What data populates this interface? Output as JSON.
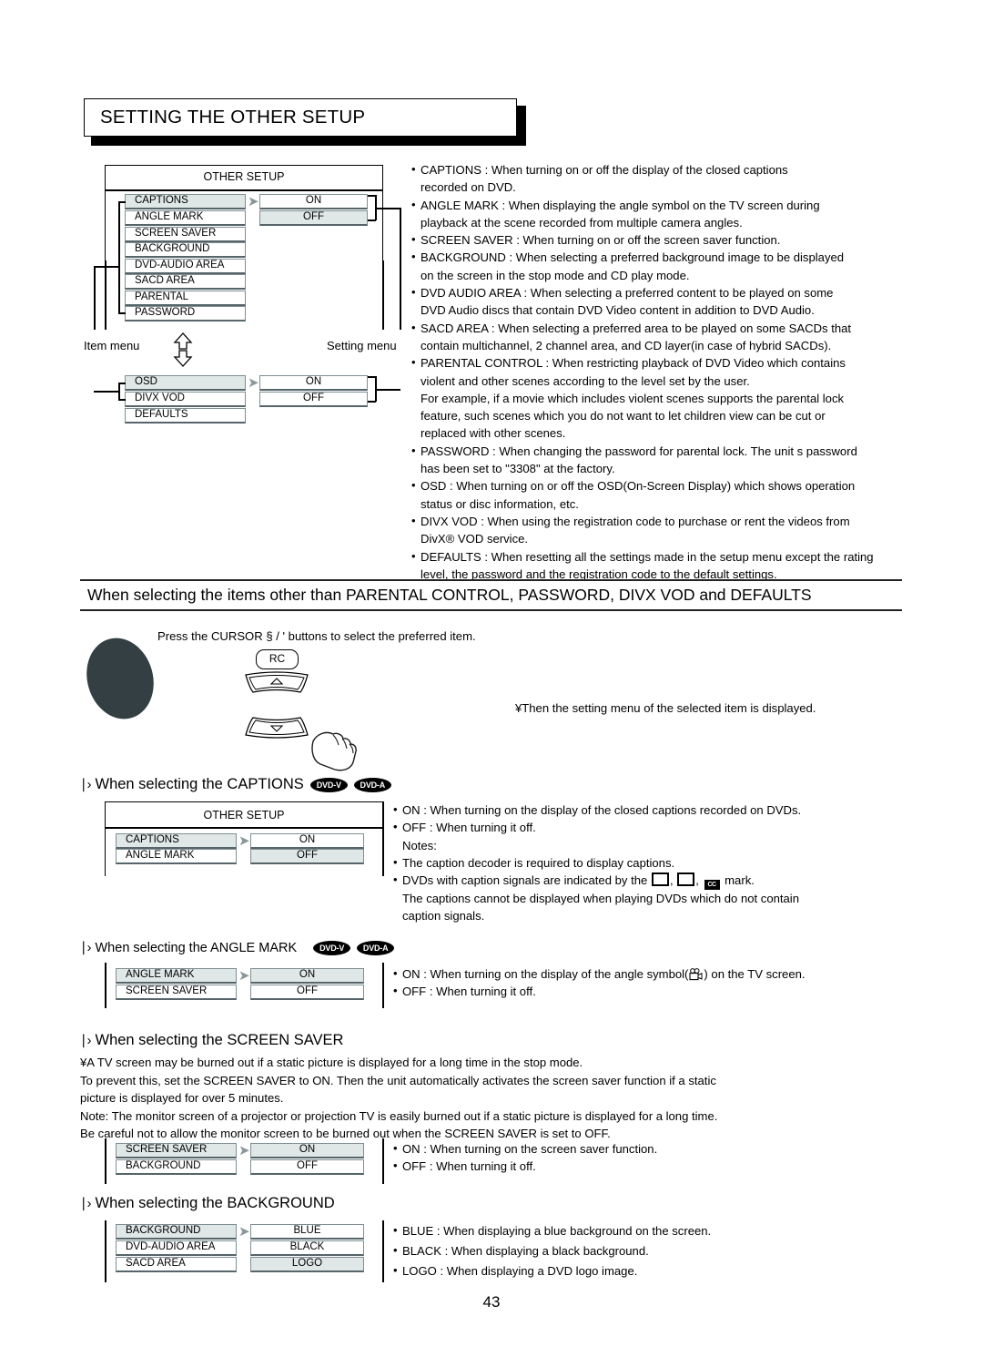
{
  "page": {
    "number": "43",
    "title": "SETTING THE OTHER SETUP"
  },
  "main_diagram": {
    "osd_title": "OTHER SETUP",
    "item_menu_label": "Item menu",
    "setting_menu_label": "Setting menu",
    "items": [
      "CAPTIONS",
      "ANGLE MARK",
      "SCREEN SAVER",
      "BACKGROUND",
      "DVD-AUDIO AREA",
      "SACD AREA",
      "PARENTAL",
      "PASSWORD"
    ],
    "settings": [
      "ON",
      "OFF"
    ],
    "lower_items": [
      "OSD",
      "DIVX VOD",
      "DEFAULTS"
    ],
    "lower_settings": [
      "ON",
      "OFF"
    ]
  },
  "descriptions": [
    {
      "text": "CAPTIONS : When turning on or off the display of the closed captions",
      "bullet": true
    },
    {
      "text": "recorded on DVD.",
      "bullet": false
    },
    {
      "text": "ANGLE MARK : When displaying the angle symbol on the TV screen during",
      "bullet": true
    },
    {
      "text": "playback at the scene recorded from multiple camera angles.",
      "bullet": false
    },
    {
      "text": "SCREEN SAVER : When turning on or off the screen saver function.",
      "bullet": true
    },
    {
      "text": "BACKGROUND : When selecting a preferred background image to be displayed",
      "bullet": true
    },
    {
      "text": "on the screen in the stop mode and CD play mode.",
      "bullet": false
    },
    {
      "text": "DVD AUDIO AREA : When selecting a preferred content to be played on some",
      "bullet": true
    },
    {
      "text": "DVD Audio discs that contain DVD Video content in addition to DVD Audio.",
      "bullet": false
    },
    {
      "text": "SACD AREA : When selecting a preferred area to be played on some SACDs that",
      "bullet": true
    },
    {
      "text": "contain multichannel, 2 channel area, and CD layer(in case of hybrid SACDs).",
      "bullet": false
    },
    {
      "text": "PARENTAL CONTROL : When restricting playback of DVD Video which contains",
      "bullet": true
    },
    {
      "text": "violent and other scenes according to the level set by the user.",
      "bullet": false
    },
    {
      "text": "For example, if a movie which includes violent scenes supports the parental lock",
      "bullet": false
    },
    {
      "text": "feature, such scenes which you do not want to let children view can be cut or",
      "bullet": false
    },
    {
      "text": "replaced with other scenes.",
      "bullet": false
    },
    {
      "text": "PASSWORD : When changing the password for parental lock. The unit s password",
      "bullet": true
    },
    {
      "text": "has been set to \"3308\" at the factory.",
      "bullet": false
    },
    {
      "text": "OSD : When turning on or off the OSD(On-Screen Display) which shows operation",
      "bullet": true
    },
    {
      "text": "status or disc information, etc.",
      "bullet": false
    },
    {
      "text": "DIVX VOD : When using the registration code to purchase or rent the videos from",
      "bullet": true
    },
    {
      "text": "DivX® VOD service.",
      "bullet": false
    },
    {
      "text": "DEFAULTS : When resetting all the settings made in the setup menu except the rating",
      "bullet": true
    },
    {
      "text": "level, the password and the registration code to the default settings.",
      "bullet": false
    }
  ],
  "section_heading": "When selecting the items other than PARENTAL CONTROL, PASSWORD, DIVX VOD and DEFAULTS",
  "step": {
    "instruction": "Press the CURSOR  § / '   buttons to select the preferred item.",
    "rc_label": "RC",
    "result_note": "¥Then the setting menu of the selected item is displayed."
  },
  "captions_section": {
    "heading": "When selecting the CAPTIONS",
    "badges": [
      "DVD-V",
      "DVD-A"
    ],
    "osd_title": "OTHER SETUP",
    "items": [
      "CAPTIONS",
      "ANGLE MARK"
    ],
    "settings": [
      "ON",
      "OFF"
    ],
    "notes_label": "Notes:",
    "lines": [
      "ON : When turning on the display of the closed captions recorded on DVDs.",
      "OFF : When turning it off.",
      "The caption decoder is required to display captions.",
      "DVDs with caption signals are indicated by the",
      "mark.",
      "The captions cannot be displayed when playing DVDs which do not contain",
      "caption signals."
    ]
  },
  "angle_mark_section": {
    "heading": "When selecting the ANGLE MARK",
    "badges": [
      "DVD-V",
      "DVD-A"
    ],
    "items": [
      "ANGLE MARK",
      "SCREEN SAVER"
    ],
    "settings": [
      "ON",
      "OFF"
    ],
    "line_on_pre": "ON : When turning on the display of the angle symbol(",
    "line_on_post": ") on the TV screen.",
    "line_off": "OFF : When turning it off."
  },
  "screen_saver_section": {
    "heading": "When selecting the SCREEN SAVER",
    "paragraph": [
      "¥A TV screen may be burned out if a static picture is displayed for a long time in the stop mode.",
      " To prevent this, set the SCREEN SAVER to ON. Then the unit automatically activates the screen saver function if a static",
      " picture is displayed for over 5 minutes.",
      "Note:  The monitor screen of a projector or projection TV is easily burned out if a static picture is displayed for a long time.",
      "          Be careful not to allow the monitor screen to be burned out when the SCREEN SAVER is set to OFF."
    ],
    "items": [
      "SCREEN SAVER",
      "BACKGROUND"
    ],
    "settings": [
      "ON",
      "OFF"
    ],
    "lines": [
      "ON : When turning on the screen saver function.",
      "OFF : When turning it off."
    ]
  },
  "background_section": {
    "heading": "When selecting the BACKGROUND",
    "items": [
      "BACKGROUND",
      "DVD-AUDIO AREA",
      "SACD AREA"
    ],
    "settings": [
      "BLUE",
      "BLACK",
      "LOGO"
    ],
    "lines": [
      "BLUE : When displaying a blue background on the screen.",
      "BLACK : When displaying a black background.",
      "LOGO : When displaying a DVD logo image."
    ]
  },
  "colors": {
    "selected_row": "#dfe7e7",
    "row_border": "#7f8f93",
    "step_ellipse": "#333f42"
  }
}
